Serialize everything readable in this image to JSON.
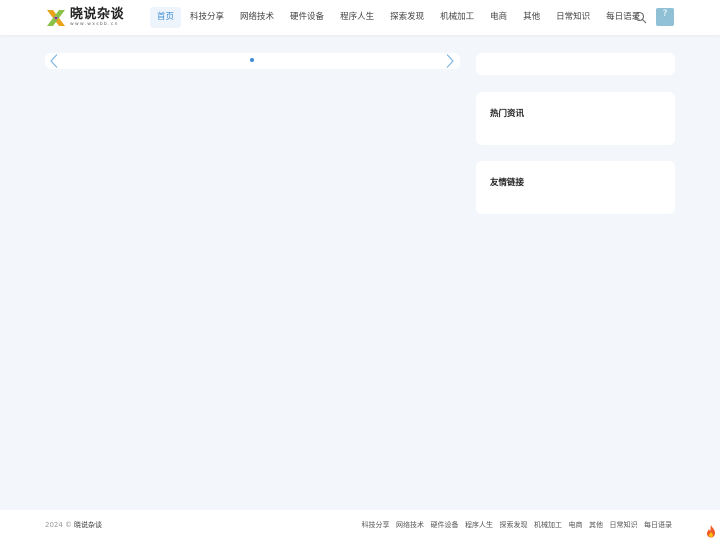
{
  "header": {
    "logo": {
      "title": "晓说杂谈",
      "subtitle": "www.wxsbb.cn"
    },
    "nav": [
      {
        "label": "首页",
        "active": true
      },
      {
        "label": "科技分享",
        "active": false
      },
      {
        "label": "网络技术",
        "active": false
      },
      {
        "label": "硬件设备",
        "active": false
      },
      {
        "label": "程序人生",
        "active": false
      },
      {
        "label": "探索发现",
        "active": false
      },
      {
        "label": "机械加工",
        "active": false
      },
      {
        "label": "电商",
        "active": false
      },
      {
        "label": "其他",
        "active": false
      },
      {
        "label": "日常知识",
        "active": false
      },
      {
        "label": "每日语录",
        "active": false
      }
    ],
    "icons": {
      "search": "search-icon",
      "avatar": "avatar"
    }
  },
  "slider": {
    "dots": 1,
    "active_dot": 1
  },
  "sidebar": {
    "hot_title": "热门资讯",
    "links_title": "友情链接"
  },
  "footer": {
    "year": "2024 ©",
    "site": "晓说杂谈",
    "links": [
      "科技分享",
      "网络技术",
      "硬件设备",
      "程序人生",
      "探索发现",
      "机械加工",
      "电商",
      "其他",
      "日常知识",
      "每日语录"
    ]
  },
  "colors": {
    "accent": "#3f8fd6",
    "background": "#f3f6fa",
    "card": "#ffffff"
  }
}
